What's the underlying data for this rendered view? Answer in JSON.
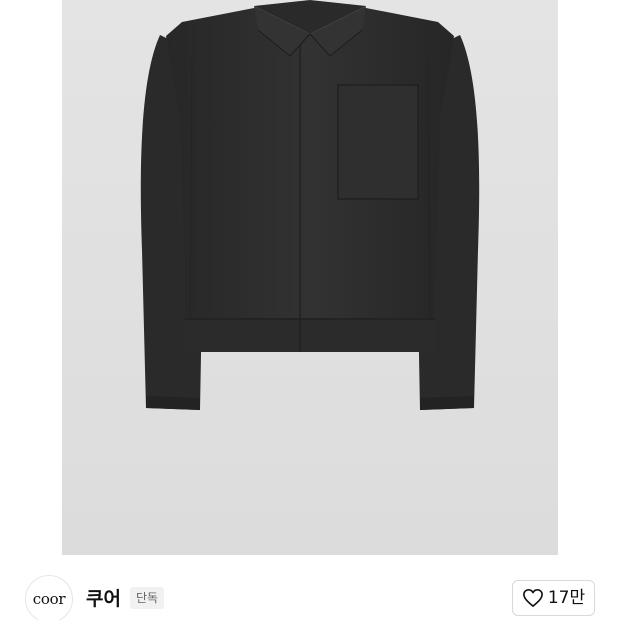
{
  "product": {
    "image_icon": "black-jacket-photo",
    "expand_icon": "expand-arrows-icon"
  },
  "brand": {
    "logo_text": "coor",
    "name": "쿠어",
    "badge": "단독"
  },
  "like": {
    "icon": "heart-outline-icon",
    "count": "17만"
  },
  "colors": {
    "image_background": "#dfdfdf",
    "jacket": "#2d2d2d",
    "badge_background": "#f1f1f1"
  }
}
